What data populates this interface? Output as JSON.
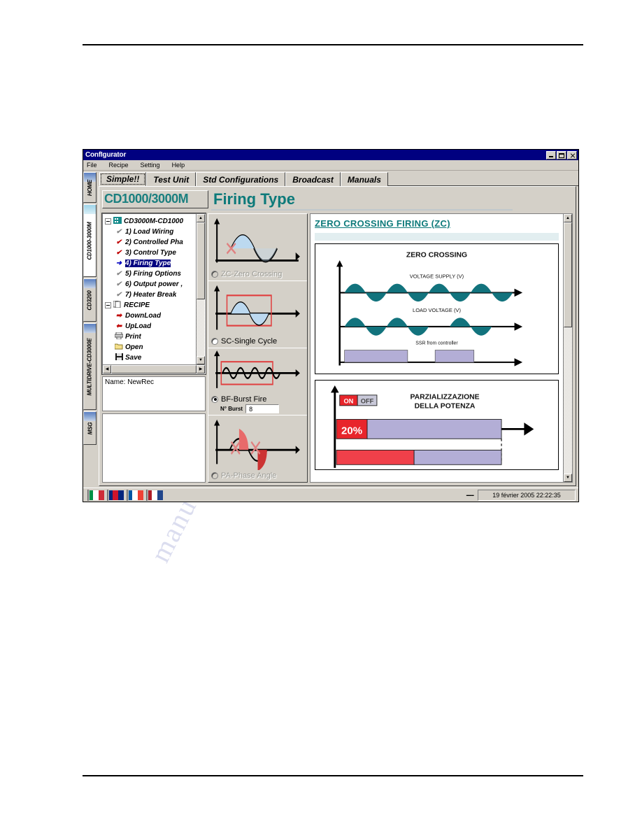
{
  "window": {
    "title": "ConfIgurator",
    "buttons": {
      "minimize": "minimize-button",
      "maximize": "maximize-button",
      "close": "close-button"
    }
  },
  "menu": {
    "items": [
      "File",
      "Recipe",
      "Setting",
      "Help"
    ]
  },
  "vertical_tabs": [
    {
      "label": "HOME",
      "active": false
    },
    {
      "label": "CD1000-3000M",
      "active": true
    },
    {
      "label": "CD3200",
      "active": false
    },
    {
      "label": "MULTIDRIVE-CD3000E",
      "active": false
    },
    {
      "label": "MSG",
      "active": false
    }
  ],
  "horizontal_tabs": [
    {
      "label": "Simple!!",
      "active": true
    },
    {
      "label": "Test Unit",
      "active": false
    },
    {
      "label": "Std Configurations",
      "active": false
    },
    {
      "label": "Broadcast",
      "active": false
    },
    {
      "label": "Manuals",
      "active": false
    }
  ],
  "header": {
    "device_selector": "CD1000/3000M",
    "page_title": "Firing Type",
    "accent_color": "#0d7a7a"
  },
  "tree": {
    "root": "CD3000M-CD1000",
    "items": [
      {
        "label": "1) Load Wiring",
        "icon": "check-grey-icon",
        "selected": false
      },
      {
        "label": "2) Controlled Pha",
        "icon": "check-red-icon",
        "selected": false
      },
      {
        "label": "3) Control Type",
        "icon": "check-red-icon",
        "selected": false
      },
      {
        "label": "4) Firing Type",
        "icon": "arrow-blue-icon",
        "selected": true
      },
      {
        "label": "5) Firing Options",
        "icon": "check-grey-icon",
        "selected": false
      },
      {
        "label": "6) Output power ,",
        "icon": "check-grey-icon",
        "selected": false
      },
      {
        "label": "7) Heater Break",
        "icon": "check-grey-icon",
        "selected": false
      }
    ],
    "recipe_group": "RECIPE",
    "recipe_items": [
      {
        "label": "DownLoad",
        "icon": "arrow-right-red-icon"
      },
      {
        "label": "UpLoad",
        "icon": "arrow-left-red-icon"
      },
      {
        "label": "Print",
        "icon": "printer-icon"
      },
      {
        "label": "Open",
        "icon": "folder-icon"
      },
      {
        "label": "Save",
        "icon": "floppy-disk-icon"
      }
    ]
  },
  "name_pane": {
    "text": "Name: NewRec"
  },
  "firing_options": [
    {
      "code": "ZC",
      "label": "ZC-Zero Crossing",
      "checked": false,
      "disabled": true,
      "wave": "zero-crossing-wave-icon"
    },
    {
      "code": "SC",
      "label": "SC-Single Cycle",
      "checked": false,
      "disabled": false,
      "wave": "single-cycle-wave-icon"
    },
    {
      "code": "BF",
      "label": "BF-Burst Fire",
      "checked": true,
      "disabled": false,
      "wave": "burst-fire-wave-icon",
      "burst_label": "N° Burst",
      "burst_value": "8"
    },
    {
      "code": "PA",
      "label": "PA-Phase Angle",
      "checked": false,
      "disabled": true,
      "wave": "phase-angle-wave-icon"
    }
  ],
  "document": {
    "heading": "ZERO CROSSING FIRING (ZC)",
    "figure1": {
      "title": "ZERO CROSSING",
      "trace1_label": "VOLTAGE SUPPLY (V)",
      "trace2_label": "LOAD VOLTAGE (V)",
      "trace3_label": "SSR from controller",
      "wave_color": "#12737d",
      "pulse_color": "#b3aed6"
    },
    "figure2": {
      "title_line1": "PARZIALIZZAZIONE",
      "title_line2": "DELLA POTENZA",
      "legend_on": "ON",
      "legend_off": "OFF",
      "bar_label": "20%",
      "on_color": "#e8252b",
      "off_color": "#b3aed6"
    }
  },
  "statusbar": {
    "flags": [
      "italy-flag-icon",
      "uk-flag-icon",
      "france-flag-icon",
      "netherlands-flag-icon"
    ],
    "separator": "----",
    "clock": "19 février 2005 22:22:35"
  },
  "watermark": {
    "line1": "manualslib.com",
    "line2": "manualslib"
  }
}
